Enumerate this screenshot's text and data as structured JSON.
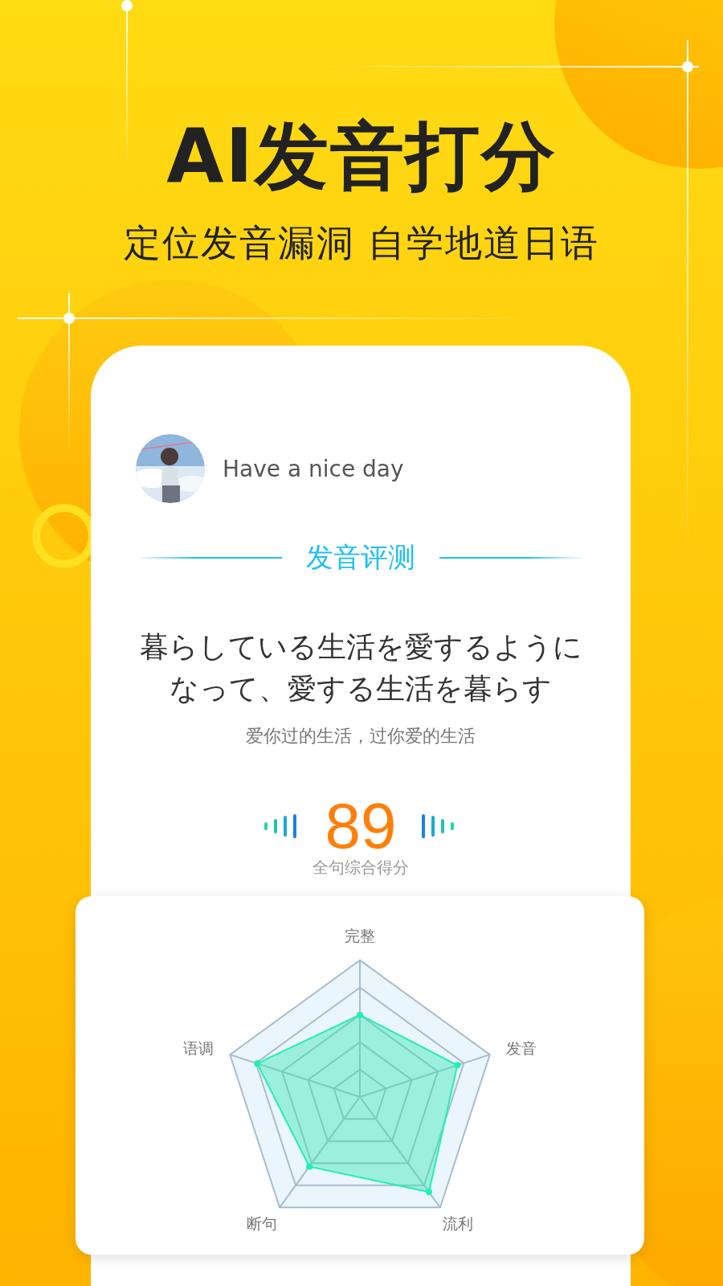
{
  "headline": "AI发音打分",
  "subtitle": "定位发音漏洞 自学地道日语",
  "user": {
    "name": "Have a nice day"
  },
  "section_title": "发音评测",
  "sentence": "暮らしている生活を愛するようになって、愛する生活を暮らす",
  "translation": "爱你过的生活，过你爱的生活",
  "score": {
    "value": "89",
    "label": "全句综合得分"
  },
  "radar": {
    "axes": [
      "完整",
      "发音",
      "流利",
      "断句",
      "语调"
    ]
  }
}
